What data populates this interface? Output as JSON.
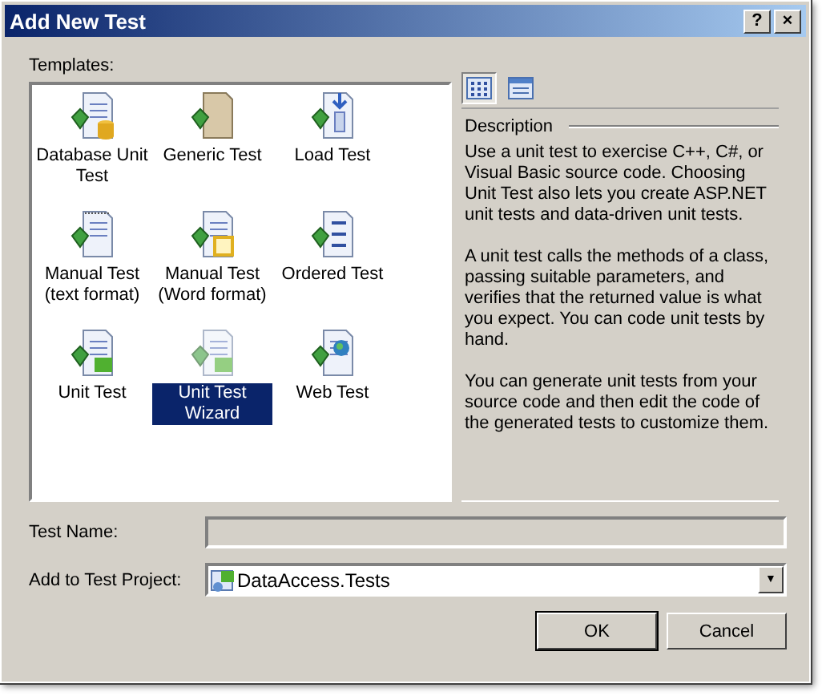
{
  "window": {
    "title": "Add New Test",
    "title_buttons": [
      "?",
      "×"
    ]
  },
  "templates_label": "Templates:",
  "templates": [
    {
      "label": "Database Unit Test",
      "kind": "database",
      "selected": false
    },
    {
      "label": "Generic Test",
      "kind": "generic",
      "selected": false
    },
    {
      "label": "Load Test",
      "kind": "load",
      "selected": false
    },
    {
      "label": "Manual Test (text format)",
      "kind": "manualtext",
      "selected": false
    },
    {
      "label": "Manual Test (Word format)",
      "kind": "manualword",
      "selected": false
    },
    {
      "label": "Ordered Test",
      "kind": "ordered",
      "selected": false
    },
    {
      "label": "Unit Test",
      "kind": "unit",
      "selected": false
    },
    {
      "label": "Unit Test Wizard",
      "kind": "unit",
      "selected": true
    },
    {
      "label": "Web Test",
      "kind": "web",
      "selected": false
    }
  ],
  "view_buttons": [
    {
      "kind": "icons",
      "selected": true
    },
    {
      "kind": "details",
      "selected": false
    }
  ],
  "description": {
    "heading": "Description",
    "paragraphs": [
      "Use a unit test to exercise C++, C#, or Visual Basic source code. Choosing Unit Test also lets you create ASP.NET unit tests and data-driven unit tests.",
      "A unit test calls the methods of a class, passing suitable parameters, and verifies that the returned value is what you expect. You can code unit tests by hand.",
      "You can generate unit tests from your source code and then edit the code of the generated tests to customize them."
    ]
  },
  "test_name": {
    "label": "Test Name:",
    "disabled": true
  },
  "test_project": {
    "label": "Add to Test Project:",
    "value": "DataAccess.Tests",
    "arrow": "▼"
  },
  "buttons": [
    "OK",
    "Cancel"
  ]
}
